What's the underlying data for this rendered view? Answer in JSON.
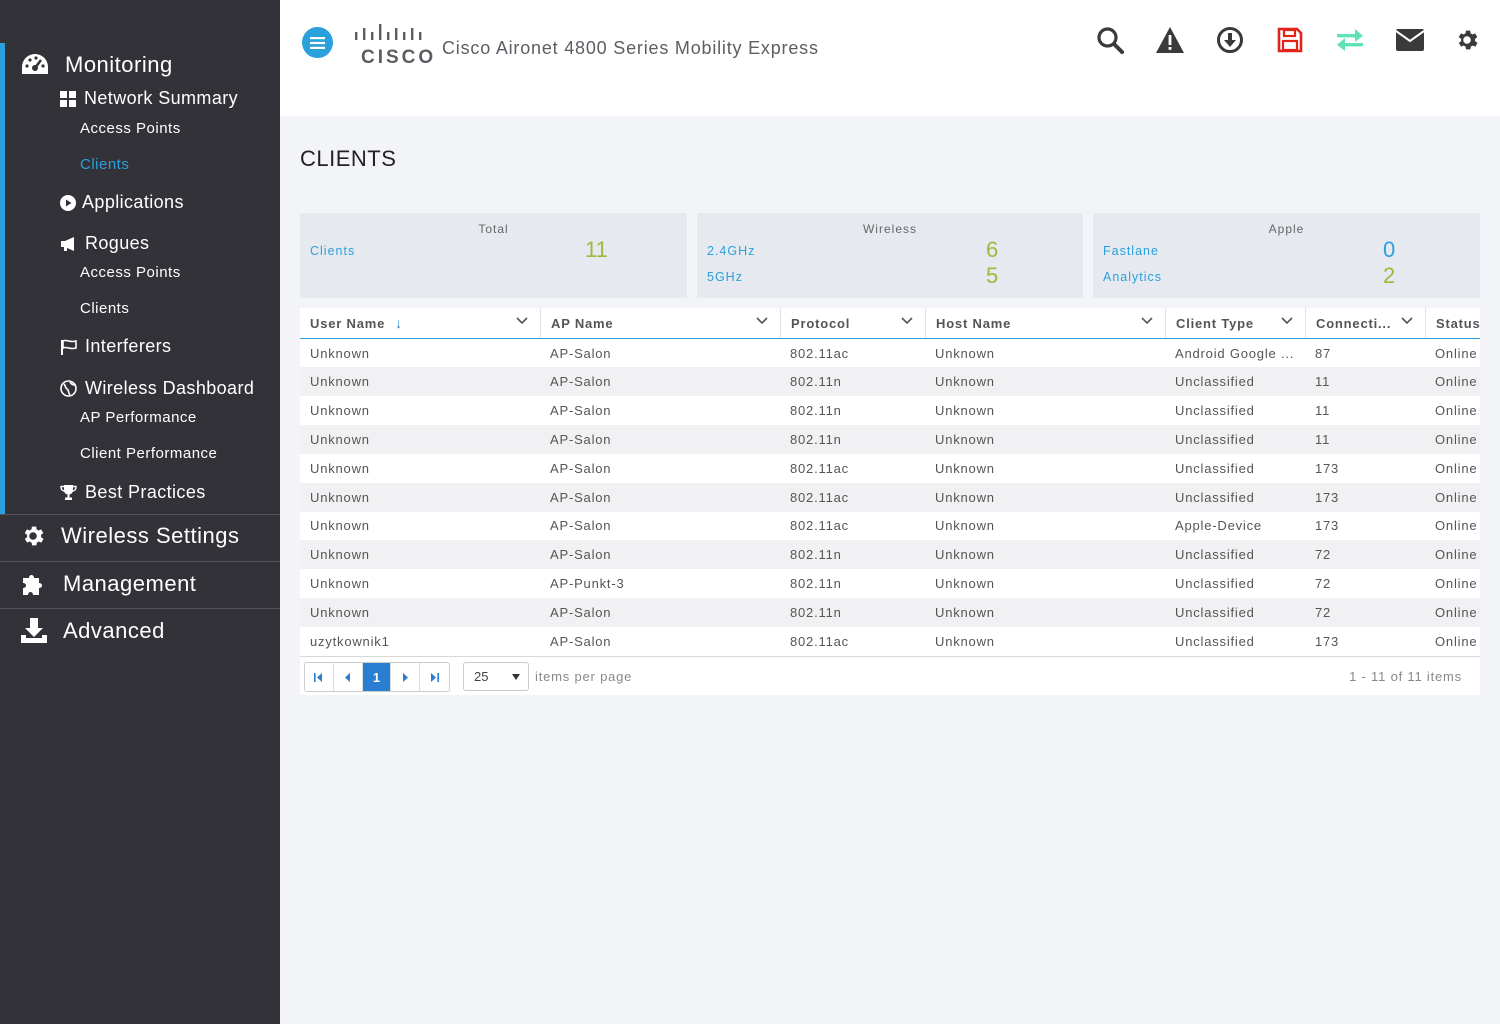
{
  "sidebar": {
    "monitoring": "Monitoring",
    "network_summary": "Network Summary",
    "ns_access_points": "Access Points",
    "ns_clients": "Clients",
    "applications": "Applications",
    "rogues": "Rogues",
    "rg_access_points": "Access Points",
    "rg_clients": "Clients",
    "interferers": "Interferers",
    "wireless_dashboard": "Wireless Dashboard",
    "ap_performance": "AP Performance",
    "client_performance": "Client Performance",
    "best_practices": "Best Practices",
    "wireless_settings": "Wireless Settings",
    "management": "Management",
    "advanced": "Advanced",
    "active_item": "Clients",
    "accent_color": "#2aa1db"
  },
  "header": {
    "logo_text": "CISCO",
    "title": "Cisco Aironet 4800 Series Mobility Express",
    "icons": [
      "search-icon",
      "alert-icon",
      "download-icon",
      "save-icon",
      "transfer-icon",
      "mail-icon",
      "gear-icon"
    ],
    "save_icon_color": "#e2231a",
    "transfer_icon_color": "#5fe3b6"
  },
  "page": {
    "title": "CLIENTS"
  },
  "stats": {
    "total": {
      "heading": "Total",
      "clients_label": "Clients",
      "clients_value": "11"
    },
    "wireless": {
      "heading": "Wireless",
      "ghz24_label": "2.4GHz",
      "ghz24_value": "6",
      "ghz5_label": "5GHz",
      "ghz5_value": "5"
    },
    "apple": {
      "heading": "Apple",
      "fastlane_label": "Fastlane",
      "fastlane_value": "0",
      "analytics_label": "Analytics",
      "analytics_value": "2"
    }
  },
  "table": {
    "columns": [
      "User Name",
      "AP Name",
      "Protocol",
      "Host Name",
      "Client Type",
      "Connecti...",
      "Status"
    ],
    "sort_indicator": "↓",
    "rows": [
      [
        "Unknown",
        "AP-Salon",
        "802.11ac",
        "Unknown",
        "Android Google ...",
        "87",
        "Online"
      ],
      [
        "Unknown",
        "AP-Salon",
        "802.11n",
        "Unknown",
        "Unclassified",
        "11",
        "Online"
      ],
      [
        "Unknown",
        "AP-Salon",
        "802.11n",
        "Unknown",
        "Unclassified",
        "11",
        "Online"
      ],
      [
        "Unknown",
        "AP-Salon",
        "802.11n",
        "Unknown",
        "Unclassified",
        "11",
        "Online"
      ],
      [
        "Unknown",
        "AP-Salon",
        "802.11ac",
        "Unknown",
        "Unclassified",
        "173",
        "Online"
      ],
      [
        "Unknown",
        "AP-Salon",
        "802.11ac",
        "Unknown",
        "Unclassified",
        "173",
        "Online"
      ],
      [
        "Unknown",
        "AP-Salon",
        "802.11ac",
        "Unknown",
        "Apple-Device",
        "173",
        "Online"
      ],
      [
        "Unknown",
        "AP-Salon",
        "802.11n",
        "Unknown",
        "Unclassified",
        "72",
        "Online"
      ],
      [
        "Unknown",
        "AP-Punkt-3",
        "802.11n",
        "Unknown",
        "Unclassified",
        "72",
        "Online"
      ],
      [
        "Unknown",
        "AP-Salon",
        "802.11n",
        "Unknown",
        "Unclassified",
        "72",
        "Online"
      ],
      [
        "uzytkownik1",
        "AP-Salon",
        "802.11ac",
        "Unknown",
        "Unclassified",
        "173",
        "Online"
      ]
    ]
  },
  "pager": {
    "current_page": "1",
    "page_size": "25",
    "per_page_label": "items per page",
    "info": "1 - 11 of 11 items"
  }
}
